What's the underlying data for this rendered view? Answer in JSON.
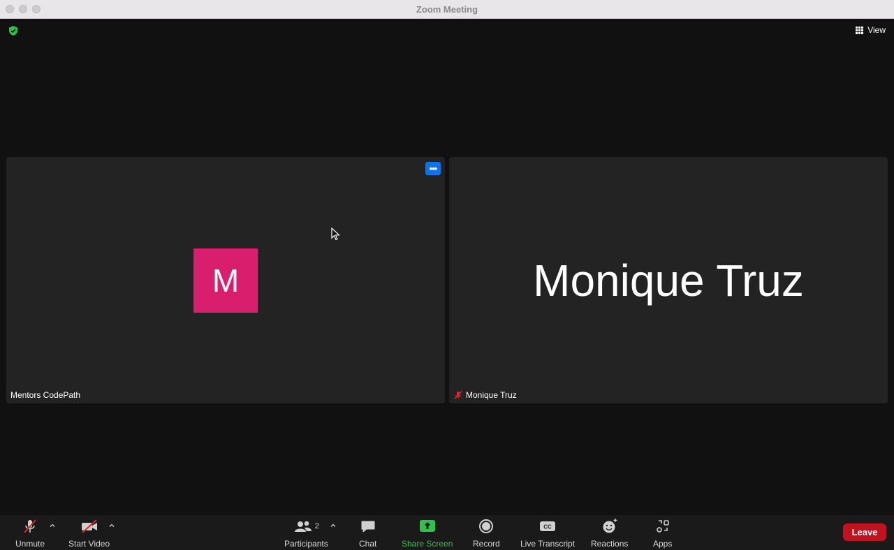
{
  "window": {
    "title": "Zoom Meeting"
  },
  "top": {
    "view_label": "View"
  },
  "tiles": [
    {
      "name": "Mentors CodePath",
      "avatar_letter": "M",
      "avatar_color": "#da1e6e"
    },
    {
      "name": "Monique Truz",
      "display_name": "Monique Truz",
      "muted": true
    }
  ],
  "toolbar": {
    "unmute": "Unmute",
    "start_video": "Start Video",
    "participants": "Participants",
    "participants_count": "2",
    "chat": "Chat",
    "share_screen": "Share Screen",
    "record": "Record",
    "live_transcript": "Live Transcript",
    "reactions": "Reactions",
    "apps": "Apps",
    "leave": "Leave"
  },
  "colors": {
    "share": "#2ec24a",
    "leave": "#c1121f",
    "accent": "#0e72ed"
  }
}
